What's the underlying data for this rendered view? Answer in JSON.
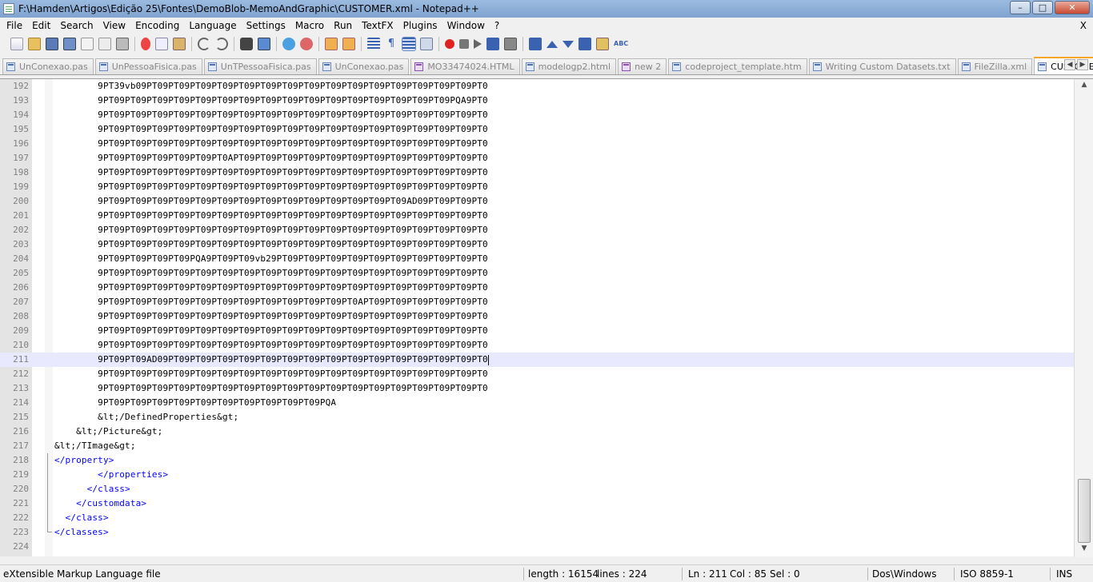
{
  "window": {
    "title": "F:\\Hamden\\Artigos\\Edição 25\\Fontes\\DemoBlob-MemoAndGraphic\\CUSTOMER.xml - Notepad++",
    "minimize": "–",
    "maximize": "□",
    "close": "✕"
  },
  "menu": {
    "items": [
      "File",
      "Edit",
      "Search",
      "View",
      "Encoding",
      "Language",
      "Settings",
      "Macro",
      "Run",
      "TextFX",
      "Plugins",
      "Window",
      "?"
    ],
    "close": "X"
  },
  "tabs": [
    {
      "label": "UnConexao.pas",
      "modified": false
    },
    {
      "label": "UnPessoaFisica.pas",
      "modified": false
    },
    {
      "label": "UnTPessoaFisica.pas",
      "modified": false
    },
    {
      "label": "UnConexao.pas",
      "modified": false
    },
    {
      "label": "MO33474024.HTML",
      "modified": true
    },
    {
      "label": "modelogp2.html",
      "modified": false
    },
    {
      "label": "new  2",
      "modified": true
    },
    {
      "label": "codeproject_template.htm",
      "modified": false
    },
    {
      "label": "Writing Custom Datasets.txt",
      "modified": false
    },
    {
      "label": "FileZilla.xml",
      "modified": false
    },
    {
      "label": "CUSTOMER.xml",
      "modified": false,
      "active": true
    }
  ],
  "editor": {
    "current_line": 211,
    "lines": [
      {
        "n": "192",
        "text": "        9PT39vb09PT09PT09PT09PT09PT09PT09PT09PT09PT09PT09PT09PT09PT09PT09PT09PT0",
        "kind": "text"
      },
      {
        "n": "193",
        "text": "        9PT09PT09PT09PT09PT09PT09PT09PT09PT09PT09PT09PT09PT09PT09PT09PT09PQA9PT0",
        "kind": "text"
      },
      {
        "n": "194",
        "text": "        9PT09PT09PT09PT09PT09PT09PT09PT09PT09PT09PT09PT09PT09PT09PT09PT09PT09PT0",
        "kind": "text"
      },
      {
        "n": "195",
        "text": "        9PT09PT09PT09PT09PT09PT09PT09PT09PT09PT09PT09PT09PT09PT09PT09PT09PT09PT0",
        "kind": "text"
      },
      {
        "n": "196",
        "text": "        9PT09PT09PT09PT09PT09PT09PT09PT09PT09PT09PT09PT09PT09PT09PT09PT09PT09PT0",
        "kind": "text"
      },
      {
        "n": "197",
        "text": "        9PT09PT09PT09PT09PT09PT0APT09PT09PT09PT09PT09PT09PT09PT09PT09PT09PT09PT0",
        "kind": "text"
      },
      {
        "n": "198",
        "text": "        9PT09PT09PT09PT09PT09PT09PT09PT09PT09PT09PT09PT09PT09PT09PT09PT09PT09PT0",
        "kind": "text"
      },
      {
        "n": "199",
        "text": "        9PT09PT09PT09PT09PT09PT09PT09PT09PT09PT09PT09PT09PT09PT09PT09PT09PT09PT0",
        "kind": "text"
      },
      {
        "n": "200",
        "text": "        9PT09PT09PT09PT09PT09PT09PT09PT09PT09PT09PT09PT09PT09PT09AD09PT09PT09PT0",
        "kind": "text"
      },
      {
        "n": "201",
        "text": "        9PT09PT09PT09PT09PT09PT09PT09PT09PT09PT09PT09PT09PT09PT09PT09PT09PT09PT0",
        "kind": "text"
      },
      {
        "n": "202",
        "text": "        9PT09PT09PT09PT09PT09PT09PT09PT09PT09PT09PT09PT09PT09PT09PT09PT09PT09PT0",
        "kind": "text"
      },
      {
        "n": "203",
        "text": "        9PT09PT09PT09PT09PT09PT09PT09PT09PT09PT09PT09PT09PT09PT09PT09PT09PT09PT0",
        "kind": "text"
      },
      {
        "n": "204",
        "text": "        9PT09PT09PT09PT09PQA9PT09PT09vb29PT09PT09PT09PT09PT09PT09PT09PT09PT09PT0",
        "kind": "text"
      },
      {
        "n": "205",
        "text": "        9PT09PT09PT09PT09PT09PT09PT09PT09PT09PT09PT09PT09PT09PT09PT09PT09PT09PT0",
        "kind": "text"
      },
      {
        "n": "206",
        "text": "        9PT09PT09PT09PT09PT09PT09PT09PT09PT09PT09PT09PT09PT09PT09PT09PT09PT09PT0",
        "kind": "text"
      },
      {
        "n": "207",
        "text": "        9PT09PT09PT09PT09PT09PT09PT09PT09PT09PT09PT09PT0APT09PT09PT09PT09PT09PT0",
        "kind": "text"
      },
      {
        "n": "208",
        "text": "        9PT09PT09PT09PT09PT09PT09PT09PT09PT09PT09PT09PT09PT09PT09PT09PT09PT09PT0",
        "kind": "text"
      },
      {
        "n": "209",
        "text": "        9PT09PT09PT09PT09PT09PT09PT09PT09PT09PT09PT09PT09PT09PT09PT09PT09PT09PT0",
        "kind": "text"
      },
      {
        "n": "210",
        "text": "        9PT09PT09PT09PT09PT09PT09PT09PT09PT09PT09PT09PT09PT09PT09PT09PT09PT09PT0",
        "kind": "text"
      },
      {
        "n": "211",
        "text": "        9PT09PT09AD09PT09PT09PT09PT09PT09PT09PT09PT09PT09PT09PT09PT09PT09PT09PT0",
        "kind": "text"
      },
      {
        "n": "212",
        "text": "        9PT09PT09PT09PT09PT09PT09PT09PT09PT09PT09PT09PT09PT09PT09PT09PT09PT09PT0",
        "kind": "text"
      },
      {
        "n": "213",
        "text": "        9PT09PT09PT09PT09PT09PT09PT09PT09PT09PT09PT09PT09PT09PT09PT09PT09PT09PT0",
        "kind": "text"
      },
      {
        "n": "214",
        "text": "        9PT09PT09PT09PT09PT09PT09PT09PT09PT09PT09PQA",
        "kind": "text"
      },
      {
        "n": "215",
        "text": "        &lt;/DefinedProperties&gt;",
        "kind": "text"
      },
      {
        "n": "216",
        "text": "    &lt;/Picture&gt;",
        "kind": "text"
      },
      {
        "n": "217",
        "text": "&lt;/TImage&gt;",
        "kind": "text"
      },
      {
        "n": "218",
        "text": "</property>",
        "kind": "tag"
      },
      {
        "n": "219",
        "text": "        </properties>",
        "kind": "tag"
      },
      {
        "n": "220",
        "text": "      </class>",
        "kind": "tag"
      },
      {
        "n": "221",
        "text": "    </customdata>",
        "kind": "tag"
      },
      {
        "n": "222",
        "text": "  </class>",
        "kind": "tag"
      },
      {
        "n": "223",
        "text": "</classes>",
        "kind": "tag"
      },
      {
        "n": "224",
        "text": "",
        "kind": "text"
      }
    ]
  },
  "status": {
    "filetype": "eXtensible Markup Language file",
    "length": "length : 16154",
    "lines": "lines : 224",
    "ln": "Ln : 211",
    "col": "Col : 85",
    "sel": "Sel : 0",
    "eol": "Dos\\Windows",
    "encoding": "ISO 8859-1",
    "mode": "INS"
  }
}
